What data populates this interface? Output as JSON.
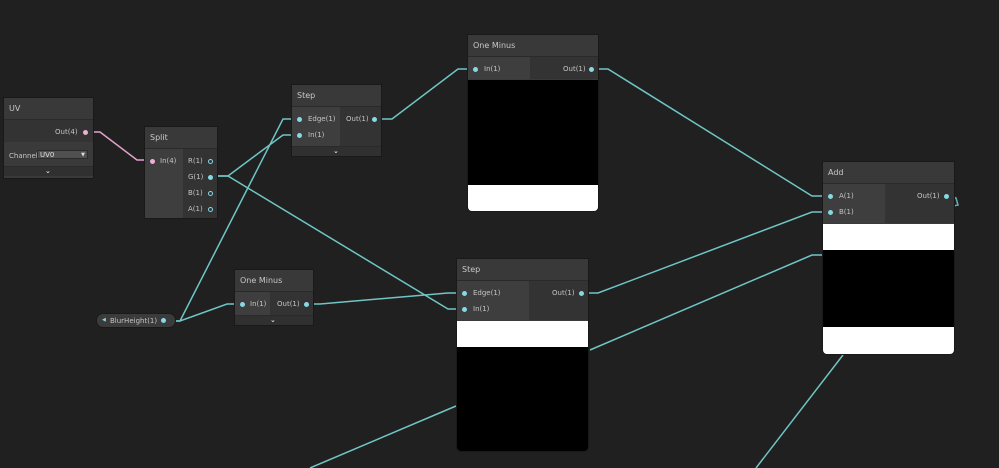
{
  "colors": {
    "background": "#202020",
    "wire_vec4": "#e5a3cc",
    "wire_vec1": "#70c5c5",
    "port_vec1": "#86d9e4",
    "port_vec4": "#eab0d3",
    "node_bg": "#3a3a3a"
  },
  "nodes": {
    "uv": {
      "title": "UV",
      "out_label": "Out(4)",
      "channel_label": "Channel",
      "channel_value": "UV0"
    },
    "split": {
      "title": "Split",
      "in_label": "In(4)",
      "outputs": [
        "R(1)",
        "G(1)",
        "B(1)",
        "A(1)"
      ]
    },
    "step_top": {
      "title": "Step",
      "inputs": [
        "Edge(1)",
        "In(1)"
      ],
      "out_label": "Out(1)"
    },
    "one_minus_top": {
      "title": "One Minus",
      "in_label": "In(1)",
      "out_label": "Out(1)"
    },
    "one_minus_bottom": {
      "title": "One Minus",
      "in_label": "In(1)",
      "out_label": "Out(1)"
    },
    "step_bottom": {
      "title": "Step",
      "inputs": [
        "Edge(1)",
        "In(1)"
      ],
      "out_label": "Out(1)"
    },
    "add": {
      "title": "Add",
      "inputs": [
        "A(1)",
        "B(1)"
      ],
      "out_label": "Out(1)"
    }
  },
  "property": {
    "label": "BlurHeight(1)"
  },
  "icons": {
    "expand": "chevron-down-icon",
    "dropdown": "dropdown-arrow-icon",
    "property_marker": "triangle-right-icon"
  }
}
